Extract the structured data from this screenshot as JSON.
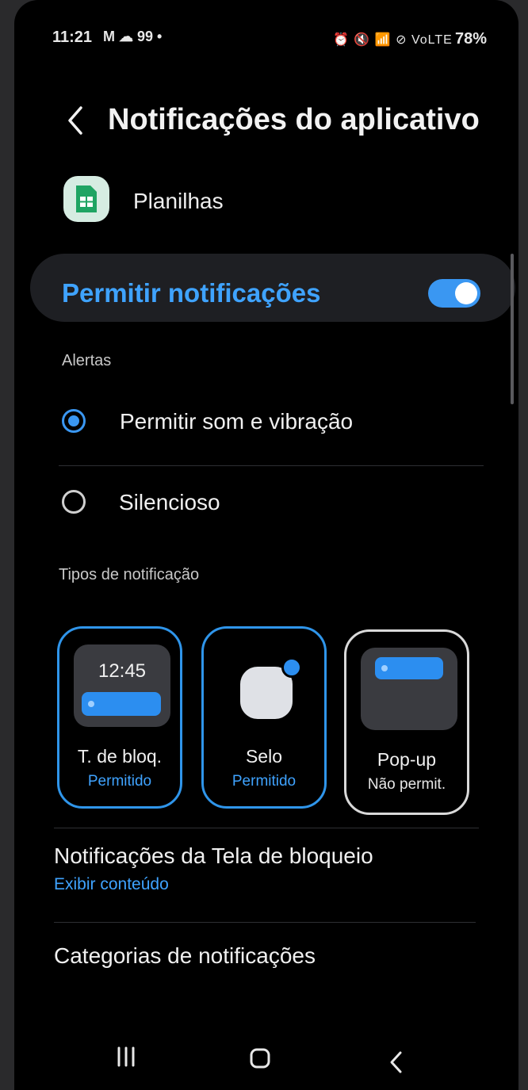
{
  "status_bar": {
    "time": "11:21",
    "left_icons": "M ☁ 99 •",
    "right_icons": "⏰ 🔇 📶 ⊘ VoLTE",
    "battery": "78%"
  },
  "header": {
    "title": "Notificações do aplicativo"
  },
  "app": {
    "name": "Planilhas"
  },
  "allow": {
    "label": "Permitir notificações",
    "enabled": true
  },
  "alerts": {
    "section_label": "Alertas",
    "options": [
      {
        "label": "Permitir som e vibração",
        "selected": true
      },
      {
        "label": "Silencioso",
        "selected": false
      }
    ]
  },
  "notification_types": {
    "section_label": "Tipos de notificação",
    "cards": [
      {
        "title": "T. de bloq.",
        "status": "Permitido",
        "preview_time": "12:45"
      },
      {
        "title": "Selo",
        "status": "Permitido"
      },
      {
        "title": "Pop-up",
        "status": "Não permit."
      }
    ]
  },
  "lock_screen": {
    "title": "Notificações da Tela de bloqueio",
    "subtitle": "Exibir conteúdo"
  },
  "categories": {
    "title": "Categorias de notificações"
  },
  "colors": {
    "accent": "#3a97f2",
    "background": "#000000",
    "card": "#1e1f23"
  }
}
